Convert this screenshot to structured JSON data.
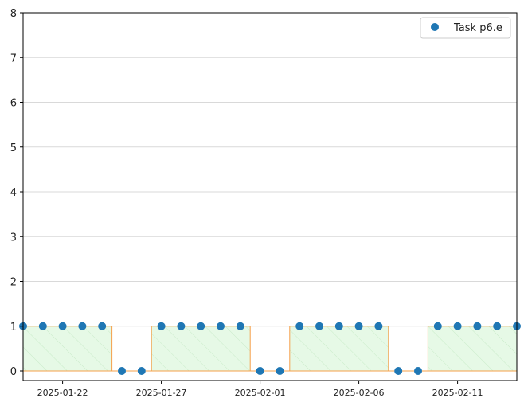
{
  "chart_data": {
    "type": "scatter",
    "series": [
      {
        "name": "Task p6.e",
        "color": "#1f77b4",
        "x": [
          "2025-01-20",
          "2025-01-21",
          "2025-01-22",
          "2025-01-23",
          "2025-01-24",
          "2025-01-25",
          "2025-01-26",
          "2025-01-27",
          "2025-01-28",
          "2025-01-29",
          "2025-01-30",
          "2025-01-31",
          "2025-02-01",
          "2025-02-02",
          "2025-02-03",
          "2025-02-04",
          "2025-02-05",
          "2025-02-06",
          "2025-02-07",
          "2025-02-08",
          "2025-02-09",
          "2025-02-10",
          "2025-02-11",
          "2025-02-12",
          "2025-02-13",
          "2025-02-14"
        ],
        "y": [
          1,
          1,
          1,
          1,
          1,
          0,
          0,
          1,
          1,
          1,
          1,
          1,
          0,
          0,
          1,
          1,
          1,
          1,
          1,
          0,
          0,
          1,
          1,
          1,
          1,
          1
        ]
      }
    ],
    "step_fill": {
      "edge_color": "#f5a04a",
      "fill_color": "#e6f9e6",
      "hatch_color": "#c9ebc9"
    },
    "xlim": [
      "2025-01-20",
      "2025-02-14"
    ],
    "ylim": [
      0,
      8
    ],
    "x_ticks": [
      "2025-01-22",
      "2025-01-27",
      "2025-02-01",
      "2025-02-06",
      "2025-02-11"
    ],
    "y_ticks": [
      "0",
      "1",
      "2",
      "3",
      "4",
      "5",
      "6",
      "7",
      "8"
    ],
    "grid": {
      "y": true,
      "x": false
    },
    "legend": {
      "position": "top-right",
      "entries": [
        "Task p6.e"
      ]
    },
    "title": "",
    "xlabel": "",
    "ylabel": ""
  }
}
